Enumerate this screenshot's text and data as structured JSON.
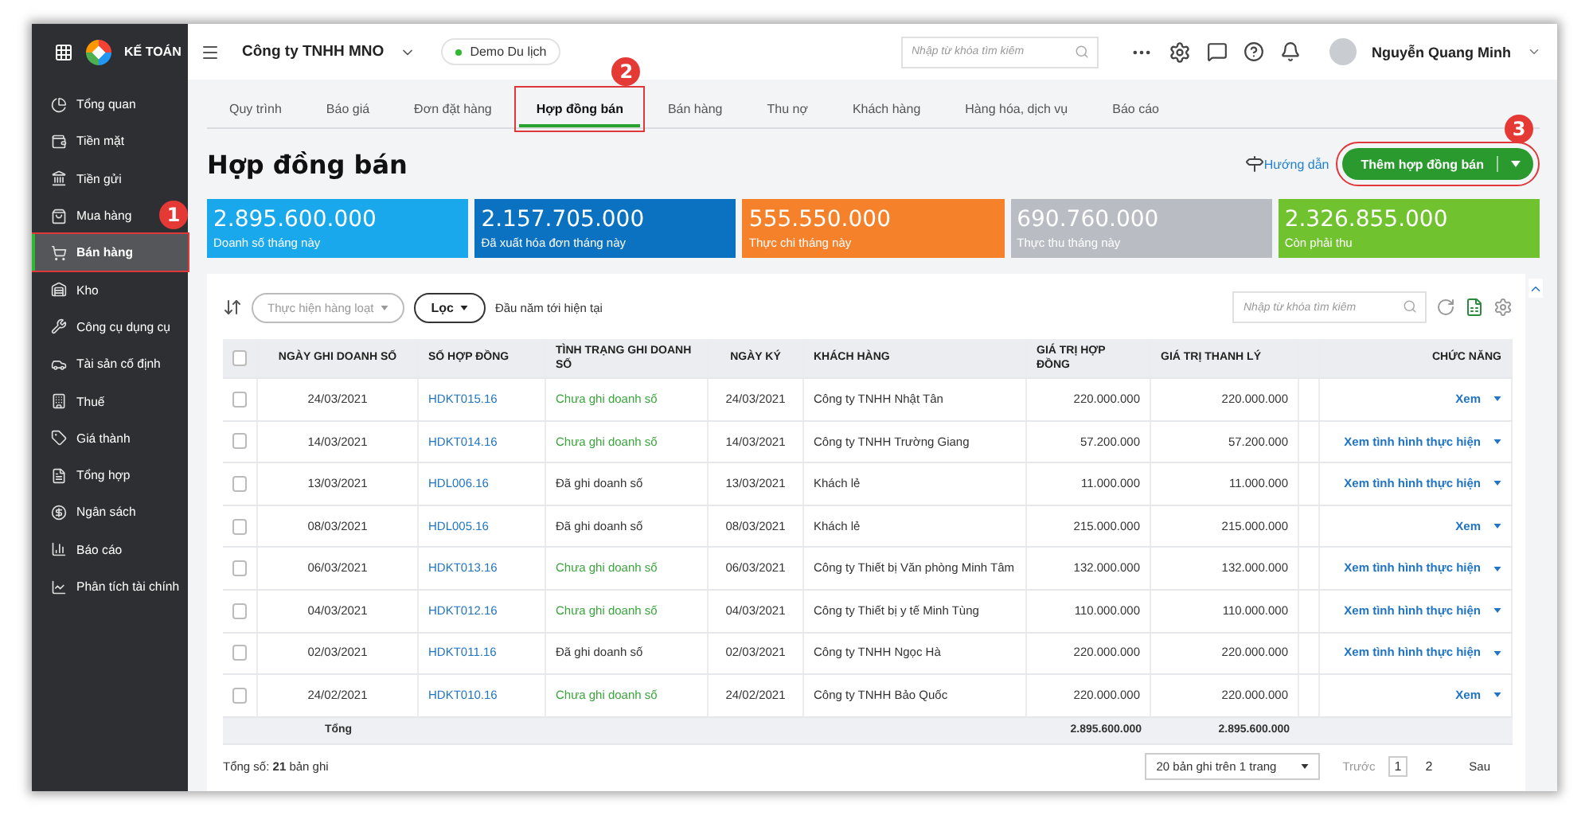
{
  "app": {
    "logo_text": "KẾ TOÁN"
  },
  "topbar": {
    "company": "Công ty TNHH MNO",
    "database": "Demo Du lịch",
    "search": {
      "placeholder": "Nhập từ khóa tìm kiếm"
    },
    "user": "Nguyễn Quang Minh"
  },
  "sidebar": {
    "items": [
      {
        "label": "Tổng quan",
        "selected": false
      },
      {
        "label": "Tiền mặt",
        "selected": false
      },
      {
        "label": "Tiền gửi",
        "selected": false
      },
      {
        "label": "Mua hàng",
        "selected": false
      },
      {
        "label": "Bán hàng",
        "selected": true,
        "callout": "1"
      },
      {
        "label": "Kho",
        "selected": false
      },
      {
        "label": "Công cụ dụng cụ",
        "selected": false
      },
      {
        "label": "Tài sản cố định",
        "selected": false
      },
      {
        "label": "Thuế",
        "selected": false
      },
      {
        "label": "Giá thành",
        "selected": false
      },
      {
        "label": "Tổng hợp",
        "selected": false
      },
      {
        "label": "Ngân sách",
        "selected": false
      },
      {
        "label": "Báo cáo",
        "selected": false
      },
      {
        "label": "Phân tích tài chính",
        "selected": false
      }
    ]
  },
  "tabs": [
    {
      "label": "Quy trình",
      "selected": false
    },
    {
      "label": "Báo giá",
      "selected": false
    },
    {
      "label": "Đơn đặt hàng",
      "selected": false
    },
    {
      "label": "Hợp đồng bán",
      "selected": true,
      "callout": "2"
    },
    {
      "label": "Bán hàng",
      "selected": false
    },
    {
      "label": "Thu nợ",
      "selected": false
    },
    {
      "label": "Khách hàng",
      "selected": false
    },
    {
      "label": "Hàng hóa, dịch vụ",
      "selected": false
    },
    {
      "label": "Báo cáo",
      "selected": false
    }
  ],
  "page": {
    "title": "Hợp đồng bán",
    "guide_link": "Hướng dẫn",
    "add_button": {
      "label": "Thêm hợp đồng bán",
      "callout": "3"
    }
  },
  "summary_cards": [
    {
      "value": "2.895.600.000",
      "label": "Doanh số tháng này",
      "color": "#19a8ec"
    },
    {
      "value": "2.157.705.000",
      "label": "Đã xuất hóa đơn tháng này",
      "color": "#0b72c1"
    },
    {
      "value": "555.550.000",
      "label": "Thực chi tháng này",
      "color": "#f5822b"
    },
    {
      "value": "690.760.000",
      "label": "Thực thu tháng này",
      "color": "#b9bdc3"
    },
    {
      "value": "2.326.855.000",
      "label": "Còn phải thu",
      "color": "#70c22f"
    }
  ],
  "toolbar": {
    "bulk_action": "Thực hiện hàng loạt",
    "filter": "Lọc",
    "period": "Đầu năm tới hiện tại",
    "search": {
      "placeholder": "Nhập từ khóa tìm kiếm"
    }
  },
  "table": {
    "all_checked": false,
    "columns": [
      "NGÀY GHI DOANH SỐ",
      "SỐ HỢP ĐỒNG",
      "TÌNH TRẠNG GHI DOANH SỐ",
      "NGÀY KÝ",
      "KHÁCH HÀNG",
      "GIÁ TRỊ HỢP ĐỒNG",
      "GIÁ TRỊ THANH LÝ",
      "CHỨC NĂNG"
    ],
    "rows": [
      {
        "checked": false,
        "date": "24/03/2021",
        "contract": "HDKT015.16",
        "status": "Chưa ghi doanh số",
        "color": "#3aa53d",
        "signed": "24/03/2021",
        "customer": "Công ty TNHH Nhật Tân",
        "value": "220.000.000",
        "settlement": "220.000.000",
        "action": "Xem"
      },
      {
        "checked": false,
        "date": "14/03/2021",
        "contract": "HDKT014.16",
        "status": "Chưa ghi doanh số",
        "color": "#3aa53d",
        "signed": "14/03/2021",
        "customer": "Công ty TNHH Trường Giang",
        "value": "57.200.000",
        "settlement": "57.200.000",
        "action": "Xem tình hình thực hiện"
      },
      {
        "checked": false,
        "date": "13/03/2021",
        "contract": "HDL006.16",
        "status": "Đã ghi doanh số",
        "color": "#333333",
        "signed": "13/03/2021",
        "customer": "Khách lẻ",
        "value": "11.000.000",
        "settlement": "11.000.000",
        "action": "Xem tình hình thực hiện"
      },
      {
        "checked": false,
        "date": "08/03/2021",
        "contract": "HDL005.16",
        "status": "Đã ghi doanh số",
        "color": "#333333",
        "signed": "08/03/2021",
        "customer": "Khách lẻ",
        "value": "215.000.000",
        "settlement": "215.000.000",
        "action": "Xem"
      },
      {
        "checked": false,
        "date": "06/03/2021",
        "contract": "HDKT013.16",
        "status": "Chưa ghi doanh số",
        "color": "#3aa53d",
        "signed": "06/03/2021",
        "customer": "Công ty Thiết bị Văn phòng Minh Tâm",
        "value": "132.000.000",
        "settlement": "132.000.000",
        "action": "Xem tình hình thực hiện"
      },
      {
        "checked": false,
        "date": "04/03/2021",
        "contract": "HDKT012.16",
        "status": "Chưa ghi doanh số",
        "color": "#3aa53d",
        "signed": "04/03/2021",
        "customer": "Công ty Thiết bị y tế Minh Tùng",
        "value": "110.000.000",
        "settlement": "110.000.000",
        "action": "Xem tình hình thực hiện"
      },
      {
        "checked": false,
        "date": "02/03/2021",
        "contract": "HDKT011.16",
        "status": "Đã ghi doanh số",
        "color": "#333333",
        "signed": "02/03/2021",
        "customer": "Công ty TNHH Ngọc Hà",
        "value": "220.000.000",
        "settlement": "220.000.000",
        "action": "Xem tình hình thực hiện"
      },
      {
        "checked": false,
        "date": "24/02/2021",
        "contract": "HDKT010.16",
        "status": "Chưa ghi doanh số",
        "color": "#3aa53d",
        "signed": "24/02/2021",
        "customer": "Công ty TNHH Bảo Quốc",
        "value": "220.000.000",
        "settlement": "220.000.000",
        "action": "Xem"
      }
    ],
    "total": {
      "label": "Tổng",
      "value": "2.895.600.000",
      "settlement": "2.895.600.000"
    }
  },
  "footer": {
    "total_text": "Tổng số: **21** bản ghi",
    "page_size": "20 bản ghi trên 1 trang",
    "prev": "Trước",
    "pages": [
      {
        "label": "1",
        "selected": true
      },
      {
        "label": "2",
        "selected": false
      }
    ],
    "next": "Sau"
  }
}
